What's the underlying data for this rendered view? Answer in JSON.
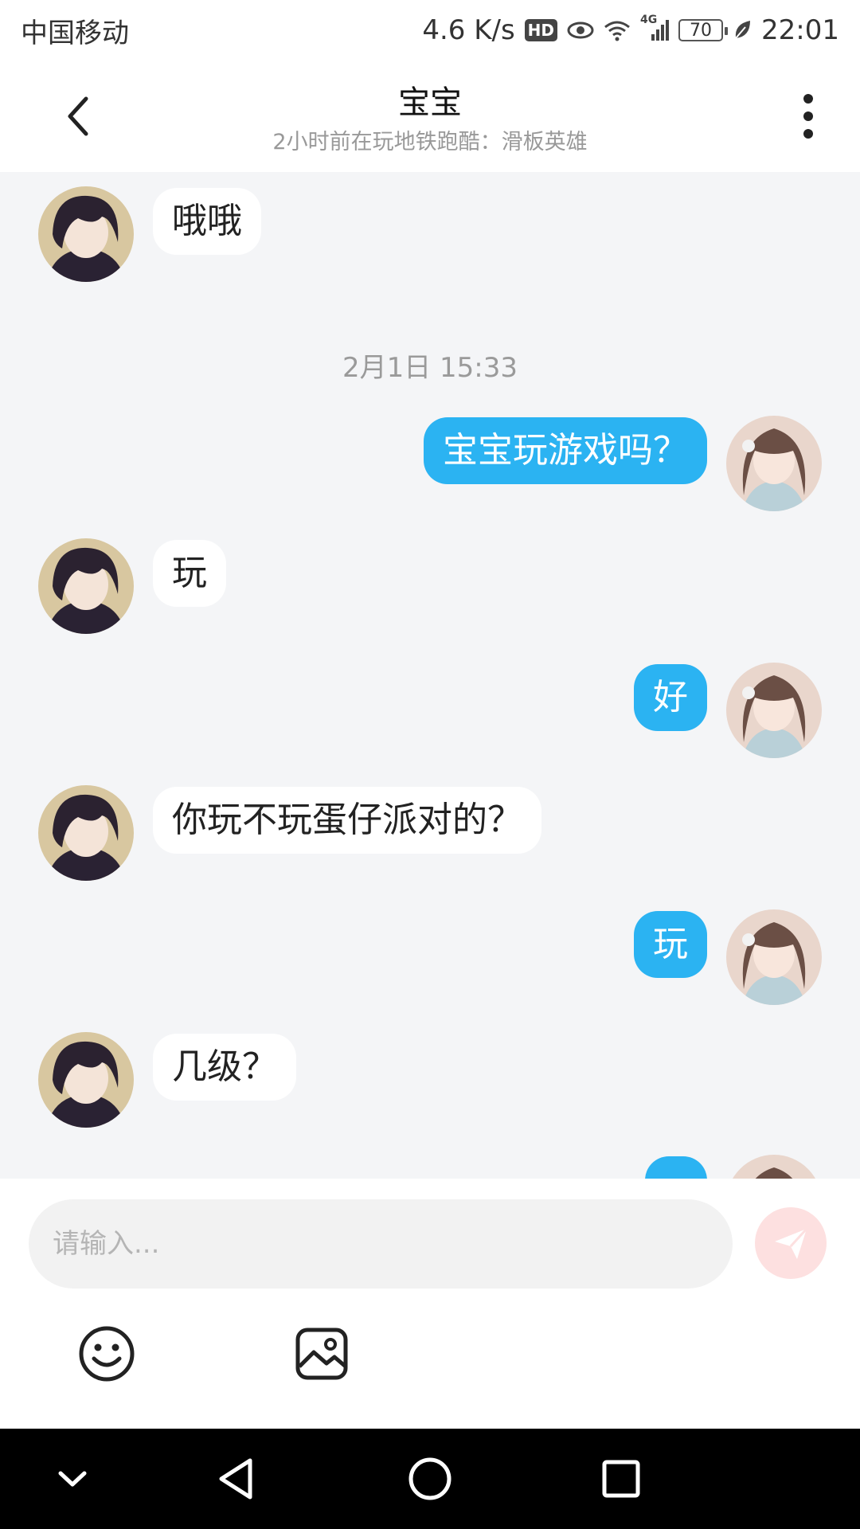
{
  "status_bar": {
    "carrier": "中国移动",
    "speed": "4.6 K/s",
    "hd_badge": "HD",
    "signal_label": "4G",
    "battery": "70",
    "time": "22:01"
  },
  "header": {
    "title": "宝宝",
    "subtitle": "2小时前在玩地铁跑酷：滑板英雄"
  },
  "messages": [
    {
      "from": "other",
      "text": "哦哦"
    },
    {
      "from": "timestamp",
      "text": "2月1日 15:33"
    },
    {
      "from": "me",
      "text": "宝宝玩游戏吗？"
    },
    {
      "from": "other",
      "text": "玩"
    },
    {
      "from": "me",
      "text": "好"
    },
    {
      "from": "other",
      "text": "你玩不玩蛋仔派对的？"
    },
    {
      "from": "me",
      "text": "玩"
    },
    {
      "from": "other",
      "text": "几级？"
    }
  ],
  "input": {
    "placeholder": "请输入..."
  },
  "colors": {
    "outgoing_bubble": "#2bb3f2",
    "incoming_bubble": "#ffffff",
    "chat_background": "#f4f5f7",
    "send_button": "#fde0e0"
  },
  "icons": {
    "back": "chevron-left-icon",
    "more": "more-vertical-icon",
    "send": "send-icon",
    "emoji": "emoji-icon",
    "image": "image-icon",
    "nav_collapse": "chevron-down-icon",
    "nav_back": "triangle-back-icon",
    "nav_home": "circle-home-icon",
    "nav_recent": "square-recent-icon"
  }
}
